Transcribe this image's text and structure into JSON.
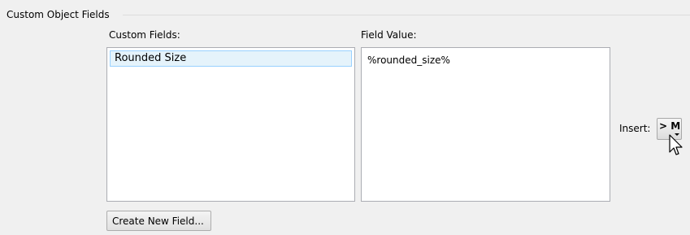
{
  "group": {
    "title": "Custom Object Fields"
  },
  "custom_fields": {
    "label": "Custom Fields:",
    "items": [
      {
        "label": "Rounded Size",
        "selected": true
      }
    ]
  },
  "field_value": {
    "label": "Field Value:",
    "value": "%rounded_size%"
  },
  "insert": {
    "label": "Insert:",
    "button_label": "> M",
    "icon": "dropdown-arrow"
  },
  "create_button": {
    "label": "Create New Field..."
  },
  "colors": {
    "selection_background": "#e5f3fb",
    "selection_border": "#99d1ff"
  }
}
